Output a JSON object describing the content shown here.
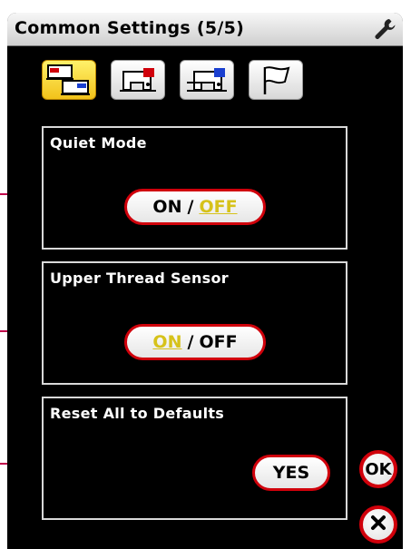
{
  "window": {
    "title": "Common Settings (5/5)",
    "title_icon": "wrench-icon"
  },
  "tabs": [
    {
      "name": "sewing-machine-settings",
      "icon": "machine-pair-icon",
      "active": true
    },
    {
      "name": "sewing-settings",
      "icon": "sewing-machine-red-icon",
      "active": false
    },
    {
      "name": "embroidery-settings",
      "icon": "embroidery-machine-blue-icon",
      "active": false
    },
    {
      "name": "general-settings",
      "icon": "flag-icon",
      "active": false
    }
  ],
  "settings": {
    "quiet_mode": {
      "label": "Quiet Mode",
      "on_label": "ON",
      "separator": "/",
      "off_label": "OFF",
      "selected": "OFF"
    },
    "upper_thread_sensor": {
      "label": "Upper Thread Sensor",
      "on_label": "ON",
      "separator": "/",
      "off_label": "OFF",
      "selected": "ON"
    },
    "reset_defaults": {
      "label": "Reset All to Defaults",
      "button_label": "YES"
    }
  },
  "footer": {
    "ok_label": "OK",
    "close_icon": "close-icon"
  },
  "colors": {
    "accent_red": "#d0000b",
    "selected_yellow": "#d6c21a",
    "active_tab": "#f2c21a",
    "background": "#000000"
  }
}
